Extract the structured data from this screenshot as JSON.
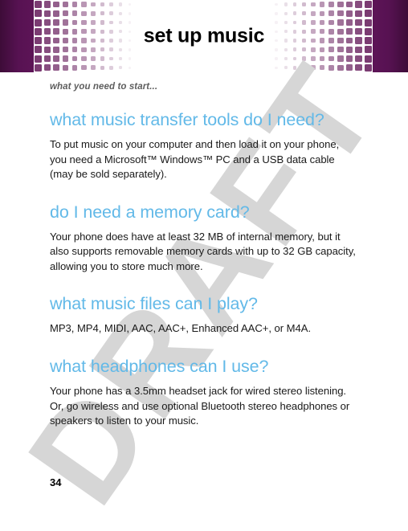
{
  "banner": {
    "title": "set up music",
    "accent_dark": "#571252",
    "accent_square": "#7b3b72"
  },
  "watermark": {
    "text": "DRAFT",
    "color": "#d6d6d6"
  },
  "content": {
    "kicker": "what you need to start...",
    "heading_color": "#62b9e8",
    "sections": [
      {
        "heading": "what music transfer tools do I need?",
        "body": "To put music on your computer and then load it on your phone, you need a Microsoft™ Windows™ PC and a USB data cable (may be sold separately)."
      },
      {
        "heading": "do I need a memory card?",
        "body": "Your phone does have at least 32 MB of internal memory, but it also supports removable memory cards with up to 32 GB capacity, allowing you to store much more."
      },
      {
        "heading": "what music files can I play?",
        "body": "MP3, MP4, MIDI, AAC, AAC+, Enhanced AAC+, or M4A."
      },
      {
        "heading": "what headphones can I use?",
        "body": "Your phone has a 3.5mm headset jack for wired stereo listening. Or, go wireless and use optional Bluetooth stereo headphones or speakers to listen to your music."
      }
    ]
  },
  "footer": {
    "page_number": "34"
  }
}
